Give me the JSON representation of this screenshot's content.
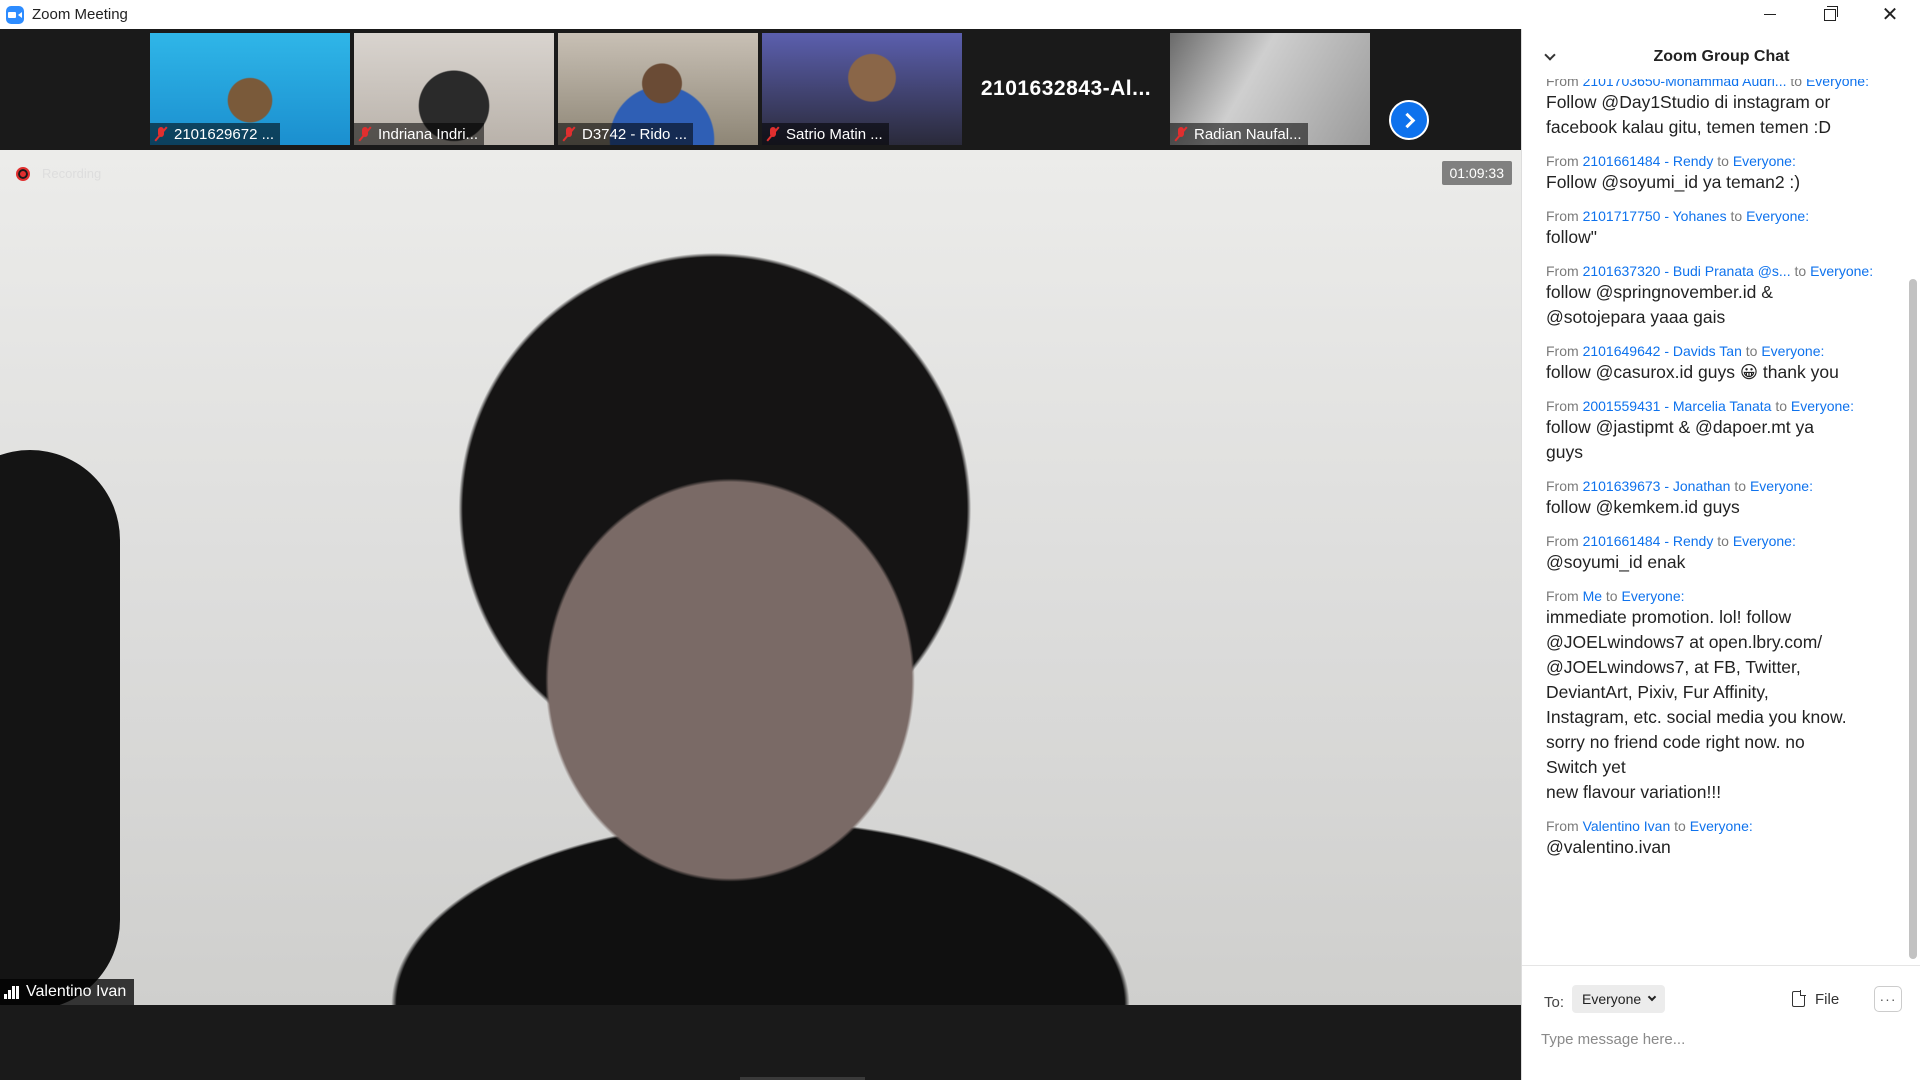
{
  "window": {
    "title": "Zoom Meeting"
  },
  "thumbnails": [
    {
      "name": "2101629672 ...",
      "muted": true
    },
    {
      "name": "Indriana Indri...",
      "muted": true
    },
    {
      "name": "D3742 - Rido ...",
      "muted": true
    },
    {
      "name": "Satrio Matin ...",
      "muted": true
    },
    {
      "name": "2101632843-Al...",
      "video": false
    },
    {
      "name": "Radian Naufal...",
      "muted": true
    }
  ],
  "main_video": {
    "recording_label": "Recording",
    "timer": "01:09:33",
    "speaker_name": "Valentino Ivan"
  },
  "chat": {
    "title": "Zoom Group Chat",
    "from_word": "From",
    "to_word": "to",
    "messages": [
      {
        "sender": "2101703650-Mohammad Audri...",
        "target": "Everyone:",
        "text": "Follow @Day1Studio di instagram or\nfacebook kalau gitu, temen temen :D"
      },
      {
        "sender": "2101661484 - Rendy",
        "target": "Everyone:",
        "text": "Follow @soyumi_id ya teman2 :)"
      },
      {
        "sender": "2101717750 - Yohanes",
        "target": "Everyone:",
        "text": "follow\""
      },
      {
        "sender": "2101637320 - Budi Pranata @s...",
        "target": "Everyone:",
        "text": "follow @springnovember.id &\n@sotojepara yaaa gais"
      },
      {
        "sender": "2101649642 - Davids Tan",
        "target": "Everyone:",
        "text": "follow @casurox.id guys 😀 thank you"
      },
      {
        "sender": "2001559431 - Marcelia Tanata",
        "target": "Everyone:",
        "text": "follow @jastipmt & @dapoer.mt ya\nguys"
      },
      {
        "sender": "2101639673 - Jonathan",
        "target": "Everyone:",
        "text": "follow @kemkem.id guys"
      },
      {
        "sender": "2101661484 - Rendy",
        "target": "Everyone:",
        "text": "@soyumi_id enak"
      },
      {
        "sender": "Me",
        "target": "Everyone:",
        "text": "immediate promotion. lol! follow\n@JOELwindows7 at open.lbry.com/\n@JOELwindows7, at FB, Twitter,\nDeviantArt, Pixiv, Fur Affinity,\nInstagram, etc. social media you know.\nsorry no friend code right now. no\nSwitch yet\nnew flavour variation!!!"
      },
      {
        "sender": "Valentino Ivan",
        "target": "Everyone:",
        "text": "@valentino.ivan"
      }
    ],
    "footer": {
      "to_label": "To:",
      "recipient": "Everyone",
      "file_label": "File",
      "more_label": "···",
      "input_placeholder": "Type message here..."
    }
  }
}
